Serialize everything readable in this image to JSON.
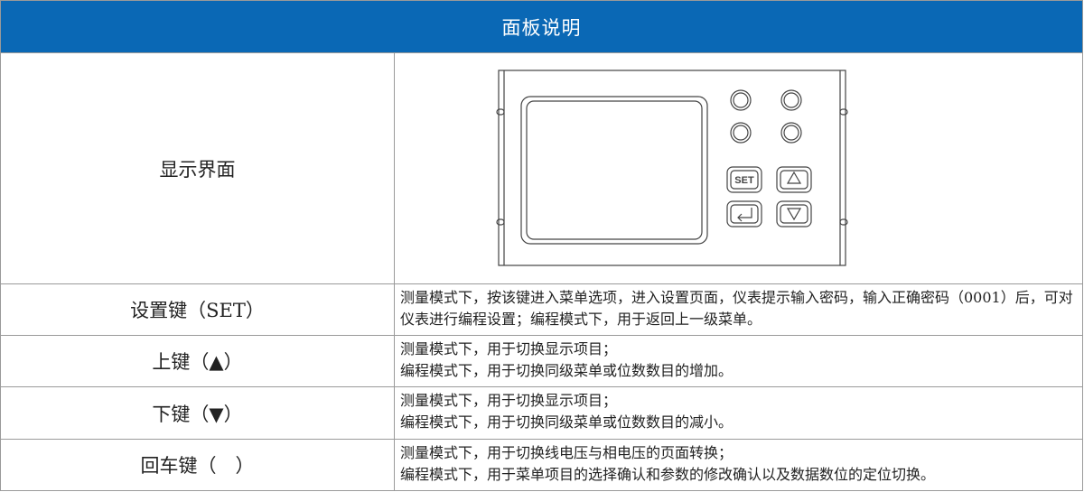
{
  "header": {
    "title": "面板说明"
  },
  "rows": [
    {
      "label": "显示界面"
    },
    {
      "label": "设置键（SET）",
      "lines": [
        "测量模式下，按该键进入菜单选项，进入设置页面，仪表提示输入密码，输入正确密码（0001）后，可对仪表进行编程设置；编程模式下，用于返回上一级菜单。"
      ]
    },
    {
      "label": "上键（▲）",
      "lines": [
        "测量模式下，用于切换显示项目；",
        "编程模式下，用于切换同级菜单或位数数目的增加。"
      ]
    },
    {
      "label": "下键（▼）",
      "lines": [
        "测量模式下，用于切换显示项目；",
        "编程模式下，用于切换同级菜单或位数数目的减小。"
      ]
    },
    {
      "label": "回车键（　）",
      "lines": [
        "测量模式下，用于切换线电压与相电压的页面转换；",
        "编程模式下，用于菜单项目的选择确认和参数的修改确认以及数据数位的定位切换。"
      ]
    }
  ],
  "panel": {
    "set_key_text": "SET"
  }
}
